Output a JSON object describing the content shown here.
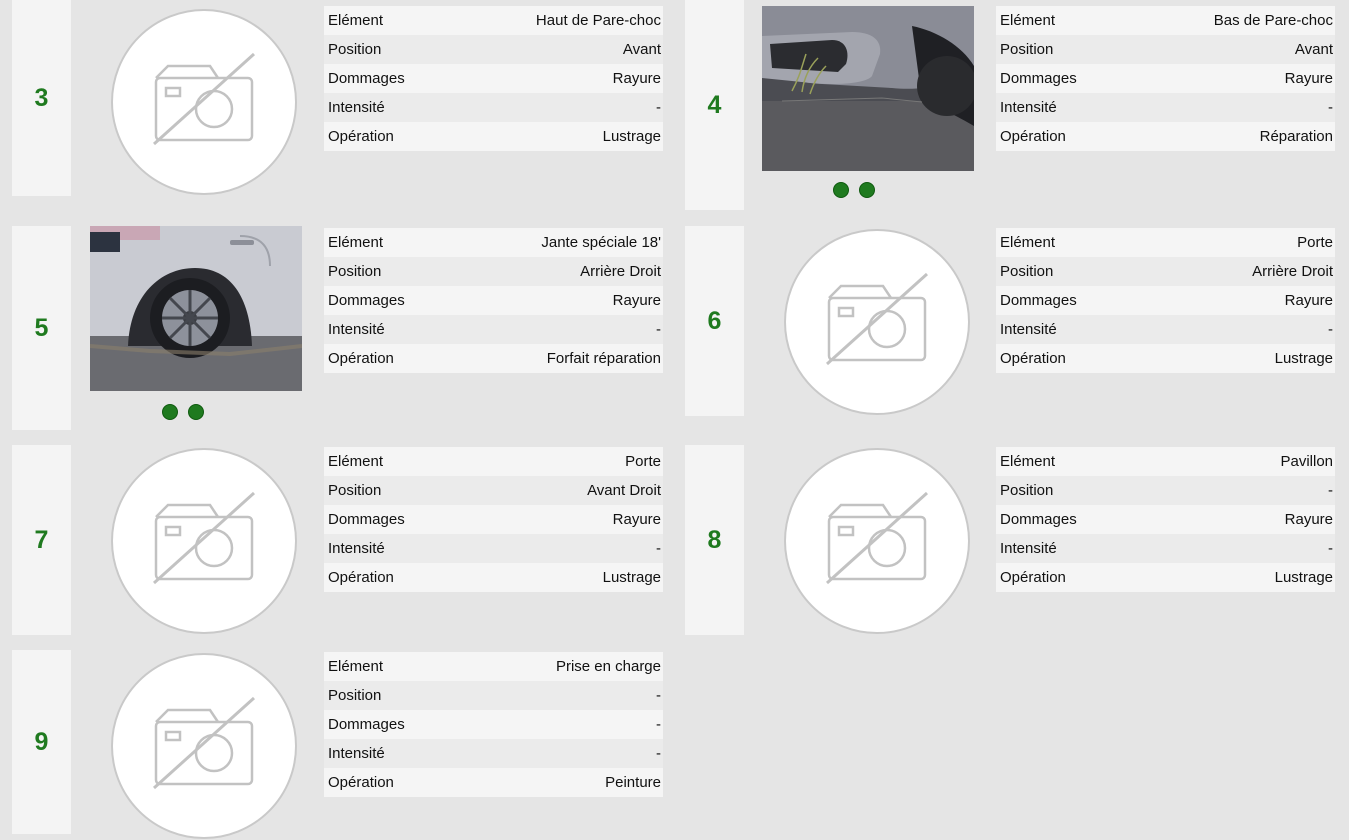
{
  "labels": {
    "element": "Elément",
    "position": "Position",
    "dommages": "Dommages",
    "intensite": "Intensité",
    "operation": "Opération"
  },
  "cards": [
    {
      "number": "3",
      "element": "Haut de Pare-choc",
      "position": "Avant",
      "dommages": "Rayure",
      "intensite": "-",
      "operation": "Lustrage",
      "image": "no-photo-icon"
    },
    {
      "number": "4",
      "element": "Bas de Pare-choc",
      "position": "Avant",
      "dommages": "Rayure",
      "intensite": "-",
      "operation": "Réparation",
      "image": "bumper-photo",
      "photo_count": 2
    },
    {
      "number": "5",
      "element": "Jante spéciale 18'",
      "position": "Arrière Droit",
      "dommages": "Rayure",
      "intensite": "-",
      "operation": "Forfait réparation",
      "image": "wheel-photo",
      "photo_count": 2
    },
    {
      "number": "6",
      "element": "Porte",
      "position": "Arrière Droit",
      "dommages": "Rayure",
      "intensite": "-",
      "operation": "Lustrage",
      "image": "no-photo-icon"
    },
    {
      "number": "7",
      "element": "Porte",
      "position": "Avant Droit",
      "dommages": "Rayure",
      "intensite": "-",
      "operation": "Lustrage",
      "image": "no-photo-icon"
    },
    {
      "number": "8",
      "element": "Pavillon",
      "position": "-",
      "dommages": "Rayure",
      "intensite": "-",
      "operation": "Lustrage",
      "image": "no-photo-icon"
    },
    {
      "number": "9",
      "element": "Prise en charge",
      "position": "-",
      "dommages": "-",
      "intensite": "-",
      "operation": "Peinture",
      "image": "no-photo-icon"
    }
  ],
  "colors": {
    "number": "#1f7a1f",
    "dot": "#1f7a1f",
    "background": "#e5e5e5",
    "row_light": "#f5f5f5",
    "row_dark": "#ebebeb"
  }
}
